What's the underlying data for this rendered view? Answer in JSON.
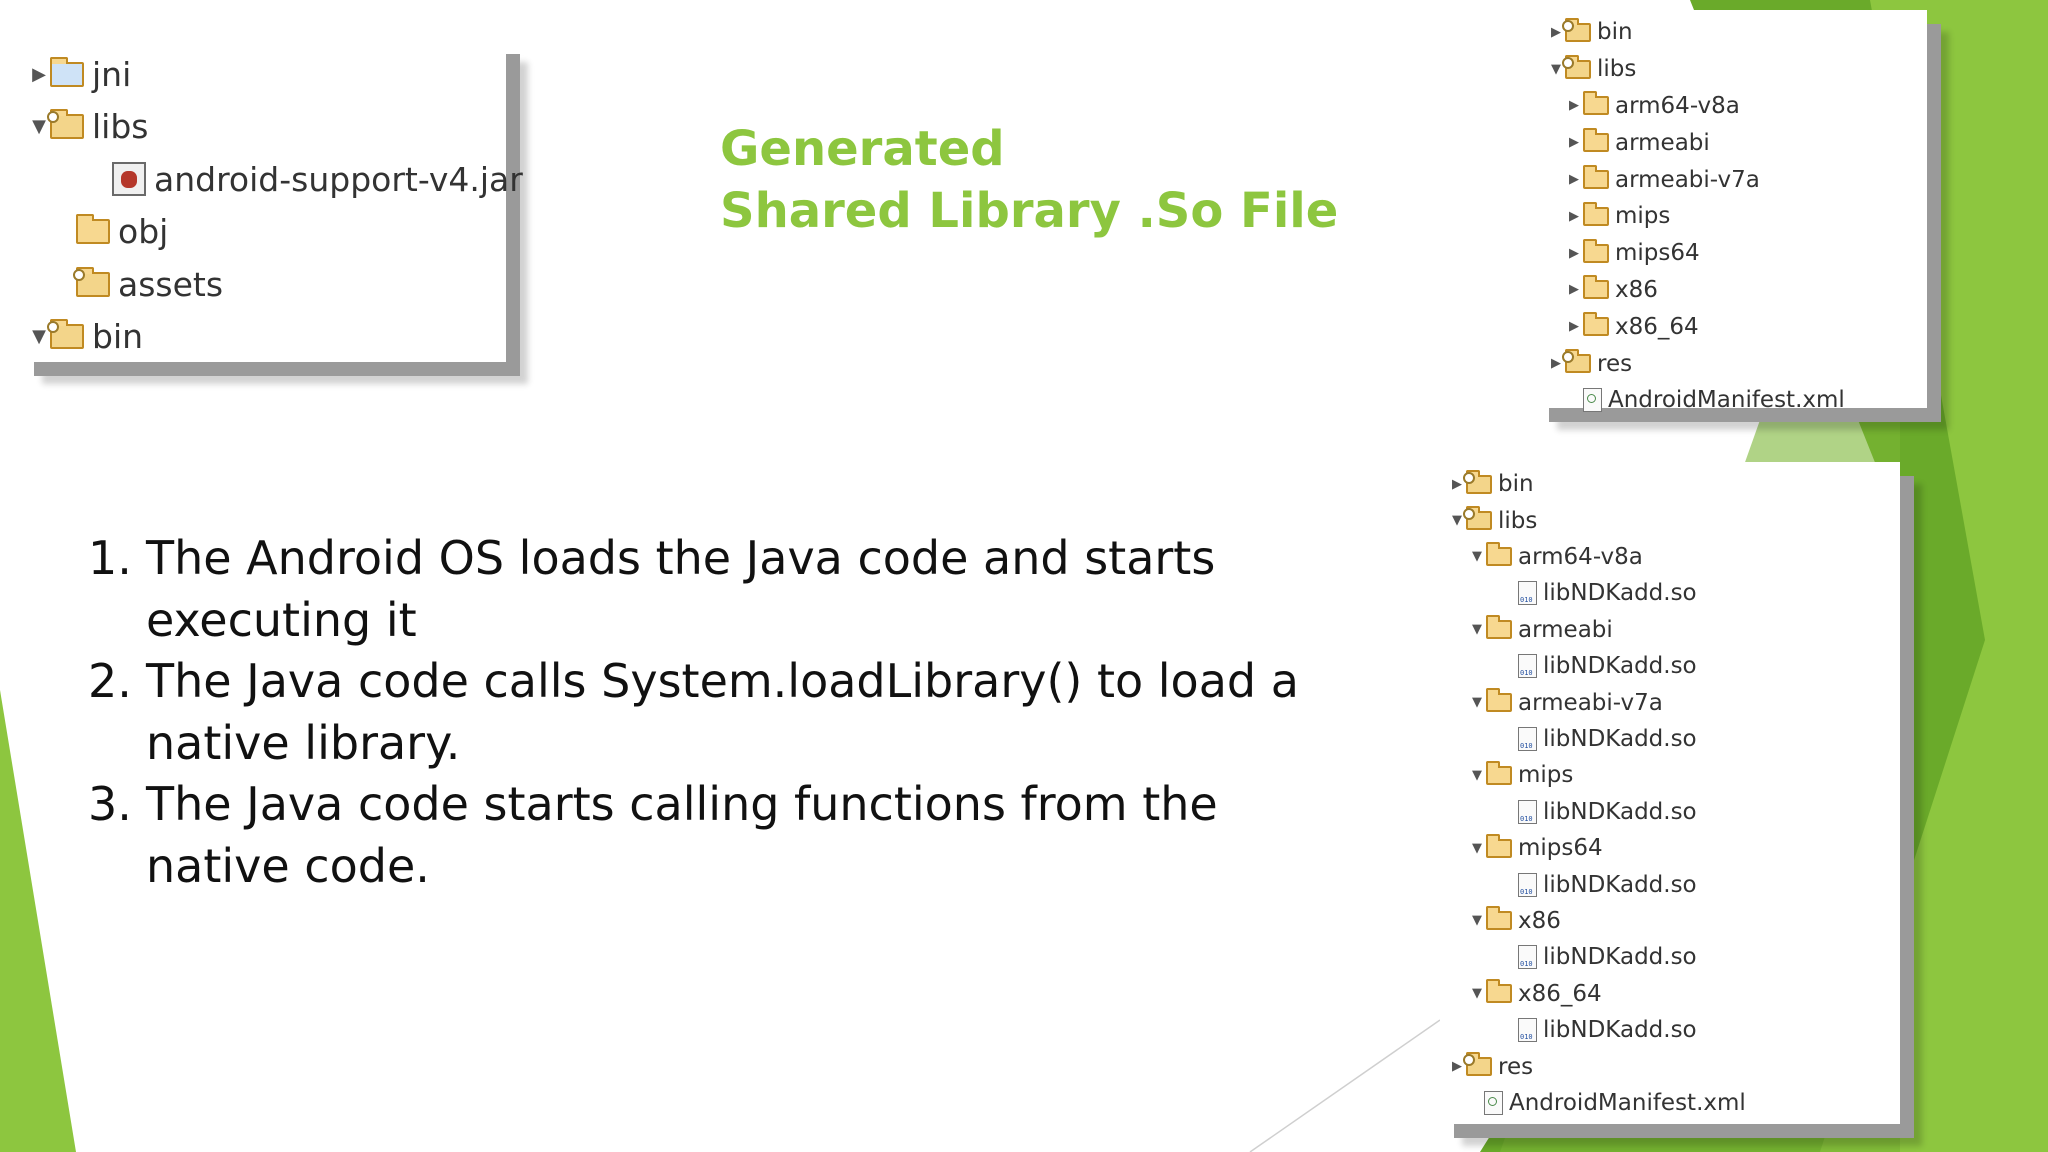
{
  "heading": {
    "line1": "Generated",
    "line2": "Shared Library .So File"
  },
  "steps": [
    {
      "num": "1.",
      "text": "The Android OS loads the Java code and starts executing it"
    },
    {
      "num": "2.",
      "text": "The Java code calls System.loadLibrary() to load a native library."
    },
    {
      "num": "3.",
      "text": "The Java code starts calling functions from the native code."
    }
  ],
  "tree_left": [
    {
      "arrow": "▶",
      "icon": "src-folder-icon",
      "label": "jni"
    },
    {
      "arrow": "▼",
      "icon": "package-folder-icon",
      "label": "libs"
    },
    {
      "arrow": "",
      "icon": "jar-icon",
      "label": "android-support-v4.jar"
    },
    {
      "arrow": "",
      "icon": "folder-icon",
      "label": "obj"
    },
    {
      "arrow": "",
      "icon": "package-folder-icon",
      "label": "assets"
    },
    {
      "arrow": "▼",
      "icon": "package-folder-icon",
      "label": "bin"
    }
  ],
  "tree_top_right": [
    {
      "arrow": "▶",
      "icon": "package-folder-icon",
      "label": "bin"
    },
    {
      "arrow": "▼",
      "icon": "package-folder-icon",
      "label": "libs"
    },
    {
      "arrow": "▶",
      "icon": "folder-icon",
      "label": "arm64-v8a"
    },
    {
      "arrow": "▶",
      "icon": "folder-icon",
      "label": "armeabi"
    },
    {
      "arrow": "▶",
      "icon": "folder-icon",
      "label": "armeabi-v7a"
    },
    {
      "arrow": "▶",
      "icon": "folder-icon",
      "label": "mips"
    },
    {
      "arrow": "▶",
      "icon": "folder-icon",
      "label": "mips64"
    },
    {
      "arrow": "▶",
      "icon": "folder-icon",
      "label": "x86"
    },
    {
      "arrow": "▶",
      "icon": "folder-icon",
      "label": "x86_64"
    },
    {
      "arrow": "▶",
      "icon": "package-folder-icon",
      "label": "res"
    },
    {
      "arrow": "",
      "icon": "xml-file-icon",
      "label": "AndroidManifest.xml"
    }
  ],
  "tree_bottom_right": [
    {
      "arrow": "▶",
      "icon": "package-folder-icon",
      "label": "bin"
    },
    {
      "arrow": "▼",
      "icon": "package-folder-icon",
      "label": "libs"
    },
    {
      "arrow": "▼",
      "icon": "folder-icon",
      "label": "arm64-v8a"
    },
    {
      "arrow": "",
      "icon": "binary-file-icon",
      "label": "libNDKadd.so"
    },
    {
      "arrow": "▼",
      "icon": "folder-icon",
      "label": "armeabi"
    },
    {
      "arrow": "",
      "icon": "binary-file-icon",
      "label": "libNDKadd.so"
    },
    {
      "arrow": "▼",
      "icon": "folder-icon",
      "label": "armeabi-v7a"
    },
    {
      "arrow": "",
      "icon": "binary-file-icon",
      "label": "libNDKadd.so"
    },
    {
      "arrow": "▼",
      "icon": "folder-icon",
      "label": "mips"
    },
    {
      "arrow": "",
      "icon": "binary-file-icon",
      "label": "libNDKadd.so"
    },
    {
      "arrow": "▼",
      "icon": "folder-icon",
      "label": "mips64"
    },
    {
      "arrow": "",
      "icon": "binary-file-icon",
      "label": "libNDKadd.so"
    },
    {
      "arrow": "▼",
      "icon": "folder-icon",
      "label": "x86"
    },
    {
      "arrow": "",
      "icon": "binary-file-icon",
      "label": "libNDKadd.so"
    },
    {
      "arrow": "▼",
      "icon": "folder-icon",
      "label": "x86_64"
    },
    {
      "arrow": "",
      "icon": "binary-file-icon",
      "label": "libNDKadd.so"
    },
    {
      "arrow": "▶",
      "icon": "package-folder-icon",
      "label": "res"
    },
    {
      "arrow": "",
      "icon": "xml-file-icon",
      "label": "AndroidManifest.xml"
    }
  ],
  "colors": {
    "accent_green": "#8dc63f",
    "dark_green": "#6aaa2a",
    "text": "#111111",
    "tree_text": "#333333"
  }
}
